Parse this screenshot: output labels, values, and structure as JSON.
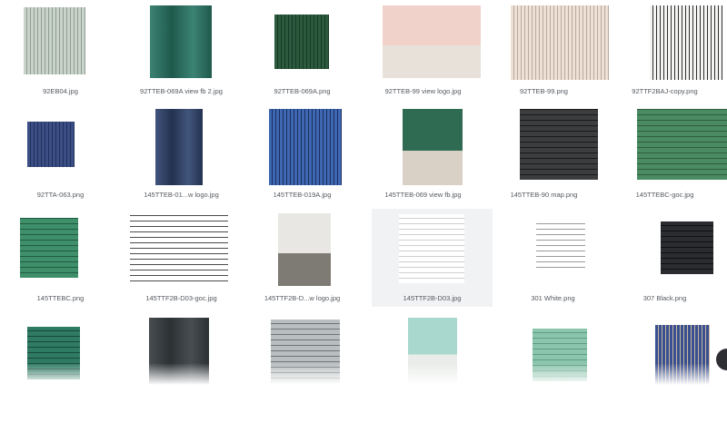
{
  "files": [
    {
      "name": "92EB04.jpg",
      "style": "vstripes",
      "c1": "#c9d3cb",
      "c2": "#8f9d90"
    },
    {
      "name": "92TTEB-069A view fb 2.jpg",
      "style": "scene",
      "c1": "#1f5a4c",
      "c2": "#3c8374"
    },
    {
      "name": "92TTEB-069A.png",
      "style": "vstripes",
      "c1": "#2b5a3e",
      "c2": "#173923"
    },
    {
      "name": "92TTEB-99 view logo.jpg",
      "style": "room",
      "c1": "#f1d2cb",
      "c2": "#e7e1da"
    },
    {
      "name": "92TTEB-99.png",
      "style": "vstripes",
      "c1": "#efe0d5",
      "c2": "#b9aaa0"
    },
    {
      "name": "92TTF2BAJ-copy.png",
      "style": "vstripes",
      "c1": "#f4f4f2",
      "c2": "#2f2f2f"
    },
    {
      "name": "92TTA-063.png",
      "style": "vstripes",
      "c1": "#3b4f86",
      "c2": "#223059"
    },
    {
      "name": "145TTEB-01...w logo.jpg",
      "style": "scene",
      "c1": "#23324f",
      "c2": "#41557c"
    },
    {
      "name": "145TTEB-019A.jpg",
      "style": "vstripes",
      "c1": "#3f68b2",
      "c2": "#1b2f60"
    },
    {
      "name": "145TTEB-069 view fb.jpg",
      "style": "room",
      "c1": "#2f6b52",
      "c2": "#d9d1c5"
    },
    {
      "name": "145TTEB-90 map.png",
      "style": "hstripes",
      "c1": "#3b3d3e",
      "c2": "#191a1b"
    },
    {
      "name": "145TTEBC-goc.jpg",
      "style": "hstripes",
      "c1": "#4b8b63",
      "c2": "#2c5e3f"
    },
    {
      "name": "145TTEBC.png",
      "style": "hstripes",
      "c1": "#3f8f6a",
      "c2": "#1f5c41"
    },
    {
      "name": "145TTF2B-D03-goc.jpg",
      "style": "hstripes",
      "c1": "#ffffff",
      "c2": "#4b4b4b"
    },
    {
      "name": "145TTF2B-D...w logo.jpg",
      "style": "room",
      "c1": "#e8e7e3",
      "c2": "#7e7a74"
    },
    {
      "name": "145TTF2B-D03.jpg",
      "style": "hstripes",
      "c1": "#ffffff",
      "c2": "#cfcfcf"
    },
    {
      "name": "301 White.png",
      "style": "hstripes",
      "c1": "#ffffff",
      "c2": "#9a9a9a"
    },
    {
      "name": "307 Black.png",
      "style": "hstripes",
      "c1": "#2a2c2f",
      "c2": "#0f1011"
    },
    {
      "name": "",
      "style": "hstripes",
      "c1": "#2f7a63",
      "c2": "#164a3a"
    },
    {
      "name": "",
      "style": "scene",
      "c1": "#2c3134",
      "c2": "#474d50"
    },
    {
      "name": "",
      "style": "hstripes",
      "c1": "#b9bec0",
      "c2": "#6f7476"
    },
    {
      "name": "",
      "style": "room",
      "c1": "#a9d8ce",
      "c2": "#e9ece9"
    },
    {
      "name": "",
      "style": "hstripes",
      "c1": "#8cc5ad",
      "c2": "#5d9d84"
    },
    {
      "name": "",
      "style": "vstripes",
      "c1": "#3a4f8f",
      "c2": "#c7b9a0"
    }
  ]
}
